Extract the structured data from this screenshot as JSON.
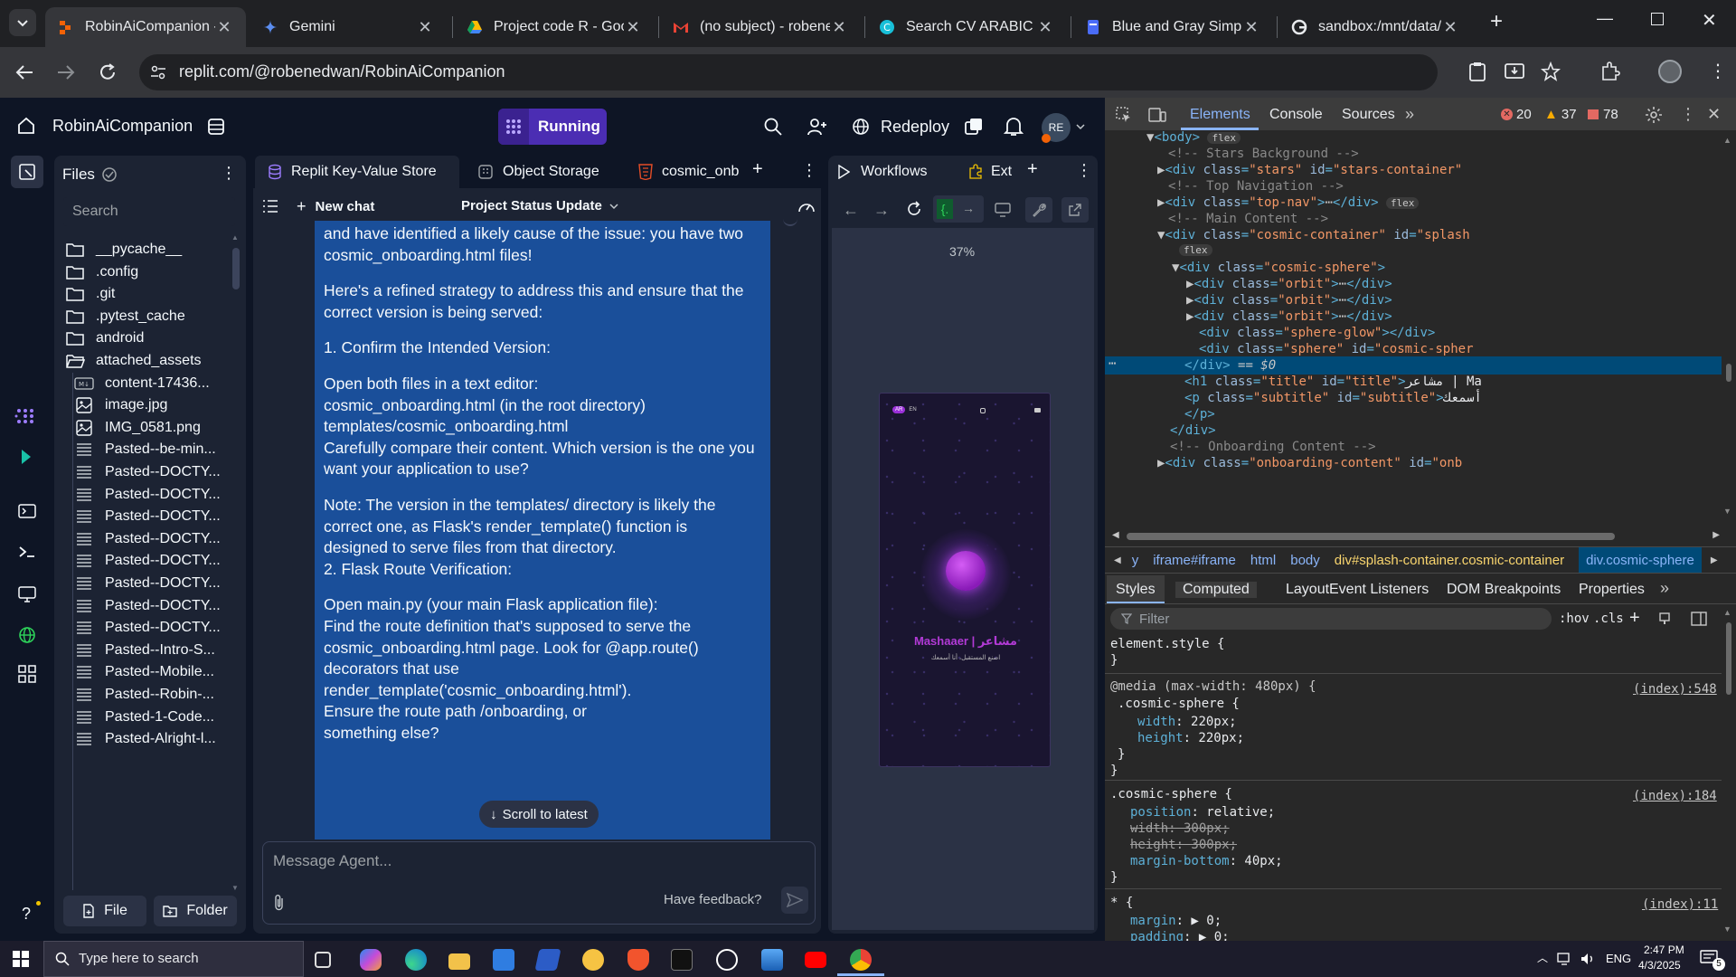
{
  "browser": {
    "tabs": [
      {
        "label": "RobinAiCompanion - Replit",
        "active": true
      },
      {
        "label": "Gemini"
      },
      {
        "label": "Project code R - Google Docs"
      },
      {
        "label": "(no subject) - robenedwan"
      },
      {
        "label": "Search CV ARABIC - Canva"
      },
      {
        "label": "Blue and Gray Simple"
      },
      {
        "label": "sandbox:/mnt/data/"
      }
    ],
    "url": "replit.com/@robenedwan/RobinAiCompanion"
  },
  "replit": {
    "project_name": "RobinAiCompanion",
    "run_status": "Running",
    "redeploy_label": "Redeploy",
    "avatar_initials": "RE",
    "files": {
      "title": "Files",
      "search_placeholder": "Search",
      "items": [
        {
          "name": "__pycache__",
          "type": "folder"
        },
        {
          "name": ".config",
          "type": "folder"
        },
        {
          "name": ".git",
          "type": "folder"
        },
        {
          "name": ".pytest_cache",
          "type": "folder"
        },
        {
          "name": "android",
          "type": "folder"
        },
        {
          "name": "attached_assets",
          "type": "folder-open"
        },
        {
          "name": "content-17436...",
          "type": "md"
        },
        {
          "name": "image.jpg",
          "type": "image"
        },
        {
          "name": "IMG_0581.png",
          "type": "image"
        },
        {
          "name": "Pasted--be-min...",
          "type": "text"
        },
        {
          "name": "Pasted--DOCTY...",
          "type": "text"
        },
        {
          "name": "Pasted--DOCTY...",
          "type": "text"
        },
        {
          "name": "Pasted--DOCTY...",
          "type": "text"
        },
        {
          "name": "Pasted--DOCTY...",
          "type": "text"
        },
        {
          "name": "Pasted--DOCTY...",
          "type": "text"
        },
        {
          "name": "Pasted--DOCTY...",
          "type": "text"
        },
        {
          "name": "Pasted--DOCTY...",
          "type": "text"
        },
        {
          "name": "Pasted--DOCTY...",
          "type": "text"
        },
        {
          "name": "Pasted--Intro-S...",
          "type": "text"
        },
        {
          "name": "Pasted--Mobile...",
          "type": "text"
        },
        {
          "name": "Pasted--Robin-...",
          "type": "text"
        },
        {
          "name": "Pasted-1-Code...",
          "type": "text"
        },
        {
          "name": "Pasted-Alright-l...",
          "type": "text"
        }
      ],
      "new_file": "File",
      "new_folder": "Folder"
    },
    "chat_tabs": [
      "Replit Key-Value Store",
      "Object Storage",
      "cosmic_onb"
    ],
    "chat_toolbar": {
      "new_chat": "New chat",
      "title": "Project Status Update"
    },
    "chat_lines": [
      "and have identified a likely cause of the issue: you have two",
      "cosmic_onboarding.html files!",
      "",
      "Here's a refined strategy to address this and ensure that the",
      "correct version is being served:",
      "",
      "1. Confirm the Intended Version:",
      "",
      "Open both files in a text editor:",
      "cosmic_onboarding.html (in the root directory)",
      "templates/cosmic_onboarding.html",
      "Carefully compare their content. Which version is the one you",
      "want your application to use?",
      "",
      "Note: The version in the templates/ directory is likely the",
      "correct one, as Flask's render_template() function is",
      "designed to serve files from that directory.",
      "2. Flask Route Verification:",
      "",
      "Open main.py (your main Flask application file):",
      "Find the route definition that's supposed to serve the",
      "cosmic_onboarding.html page. Look for @app.route()",
      "decorators that use",
      "render_template('cosmic_onboarding.html').",
      "Ensure the route path                        /onboarding, or",
      "something else?"
    ],
    "scroll_to_latest": "Scroll to latest",
    "message_placeholder": "Message Agent...",
    "feedback": "Have feedback?",
    "preview_tabs": [
      "Workflows",
      "Ext"
    ],
    "zoom": "37%",
    "phone": {
      "title": "Mashaaer | مشاعر",
      "subtitle": "اصنع المستقبل، أنا أسمعك",
      "lang": "EN",
      "lang_badge": "AR"
    }
  },
  "devtools": {
    "tabs": [
      "Elements",
      "Console",
      "Sources"
    ],
    "errors": "20",
    "warnings": "37",
    "issues": "78",
    "breadcrumbs": [
      "y",
      "iframe#iframe",
      "html",
      "body",
      "div#splash-container.cosmic-container",
      "div.cosmic-sphere"
    ],
    "style_tabs": [
      "Styles",
      "Computed",
      "Layout",
      "Event Listeners",
      "DOM Breakpoints",
      "Properties"
    ],
    "filter_placeholder": "Filter",
    "hov": ":hov",
    "cls": ".cls",
    "element_style": "element.style {",
    "media_query": "@media (max-width: 480px) {",
    "rules": {
      "r1_loc": "(index):548",
      "r2_loc": "(index):184",
      "r3_loc": "(index):11"
    },
    "dom_flex": "flex",
    "selected_suffix": "== $0"
  },
  "taskbar": {
    "search_placeholder": "Type here to search",
    "time": "2:47 PM",
    "date": "4/3/2025",
    "lang": "ENG",
    "notif_count": "5"
  }
}
